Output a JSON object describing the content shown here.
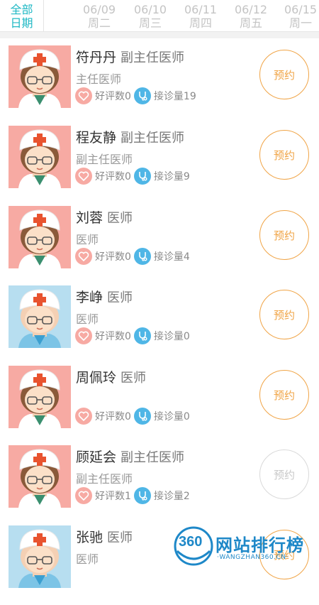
{
  "date_bar": {
    "all_dates_line1": "全部",
    "all_dates_line2": "日期",
    "dates": [
      {
        "date": "06/09",
        "weekday": "周二"
      },
      {
        "date": "06/10",
        "weekday": "周三"
      },
      {
        "date": "06/11",
        "weekday": "周四"
      },
      {
        "date": "06/12",
        "weekday": "周五"
      },
      {
        "date": "06/15",
        "weekday": "周一"
      }
    ]
  },
  "doctors": [
    {
      "name": "符丹丹",
      "title": "副主任医师",
      "subtitle": "主任医师",
      "good_reviews": "好评数0",
      "visits": "接诊量19",
      "book_label": "预约",
      "avatar": "female-nurse-avatar",
      "avatar_color": "#f7aaa3",
      "book_enabled": true
    },
    {
      "name": "程友静",
      "title": "副主任医师",
      "subtitle": "副主任医师",
      "good_reviews": "好评数0",
      "visits": "接诊量9",
      "book_label": "预约",
      "avatar": "female-nurse-avatar",
      "avatar_color": "#f7aaa3",
      "book_enabled": true
    },
    {
      "name": "刘蓉",
      "title": "医师",
      "subtitle": "医师",
      "good_reviews": "好评数0",
      "visits": "接诊量4",
      "book_label": "预约",
      "avatar": "female-nurse-avatar",
      "avatar_color": "#f7aaa3",
      "book_enabled": true
    },
    {
      "name": "李峥",
      "title": "医师",
      "subtitle": "医师",
      "good_reviews": "好评数0",
      "visits": "接诊量0",
      "book_label": "预约",
      "avatar": "male-doctor-avatar",
      "avatar_color": "#b7def0",
      "book_enabled": true
    },
    {
      "name": "周佩玲",
      "title": "医师",
      "subtitle": "",
      "good_reviews": "好评数0",
      "visits": "接诊量0",
      "book_label": "预约",
      "avatar": "female-nurse-avatar",
      "avatar_color": "#f7aaa3",
      "book_enabled": true
    },
    {
      "name": "顾延会",
      "title": "副主任医师",
      "subtitle": "副主任医师",
      "good_reviews": "好评数1",
      "visits": "接诊量2",
      "book_label": "预约",
      "avatar": "female-nurse-avatar",
      "avatar_color": "#f7aaa3",
      "book_enabled": false
    },
    {
      "name": "张驰",
      "title": "医师",
      "subtitle": "医师",
      "good_reviews": "",
      "visits": "",
      "book_label": "预约",
      "avatar": "male-doctor-avatar",
      "avatar_color": "#b7def0",
      "book_enabled": true
    }
  ],
  "watermark": {
    "text": "网站排行榜",
    "sub": "·WANGZHAN360.CN·",
    "logo": "360"
  },
  "colors": {
    "accent": "#1fb8c4",
    "book": "#f0a446",
    "heart": "#f7aaa3",
    "steth": "#4fb6e6"
  }
}
